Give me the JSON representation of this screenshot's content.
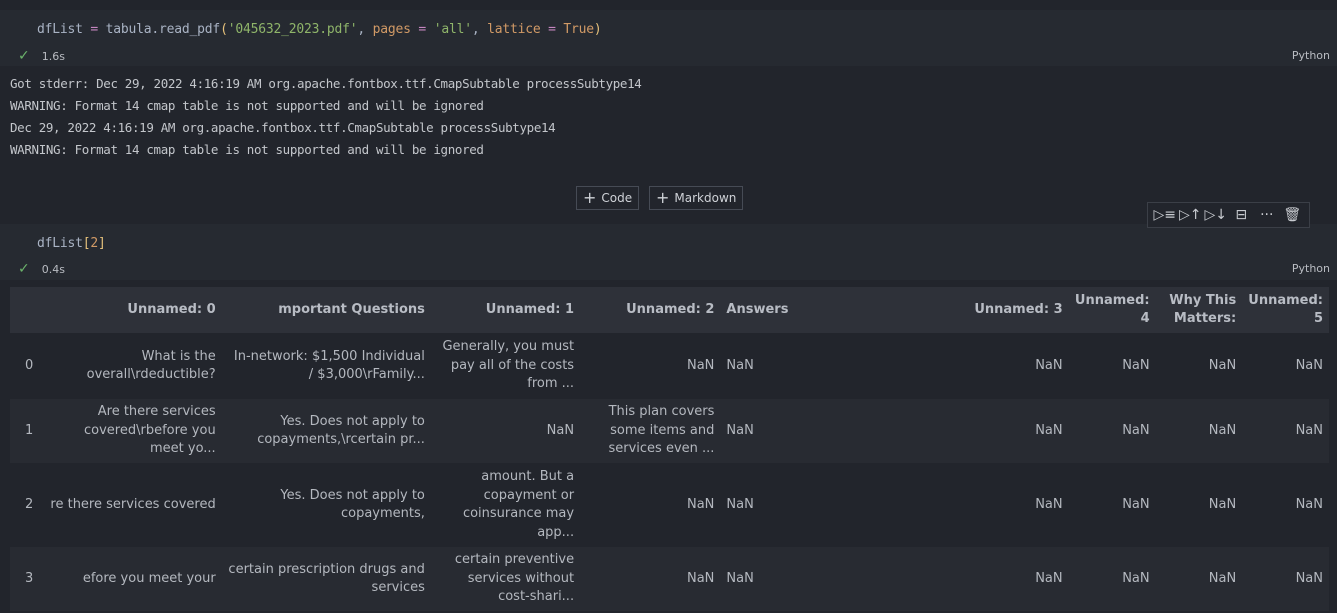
{
  "cells": [
    {
      "code_tokens": [
        {
          "t": "dfList ",
          "c": ""
        },
        {
          "t": "=",
          "c": "tok-op"
        },
        {
          "t": " tabula.read_pdf",
          "c": ""
        },
        {
          "t": "(",
          "c": "tok-paren"
        },
        {
          "t": "'045632_2023.pdf'",
          "c": "tok-str"
        },
        {
          "t": ", ",
          "c": ""
        },
        {
          "t": "pages",
          "c": "tok-kw"
        },
        {
          "t": " ",
          "c": ""
        },
        {
          "t": "=",
          "c": "tok-op"
        },
        {
          "t": " ",
          "c": ""
        },
        {
          "t": "'all'",
          "c": "tok-str"
        },
        {
          "t": ", ",
          "c": ""
        },
        {
          "t": "lattice",
          "c": "tok-kw"
        },
        {
          "t": " ",
          "c": ""
        },
        {
          "t": "=",
          "c": "tok-op"
        },
        {
          "t": " ",
          "c": ""
        },
        {
          "t": "True",
          "c": "tok-kw"
        },
        {
          "t": ")",
          "c": "tok-paren"
        }
      ],
      "exec_time": "1.6s",
      "language": "Python",
      "status_icon": "check-icon",
      "output_lines": [
        "Got stderr: Dec 29, 2022 4:16:19 AM org.apache.fontbox.ttf.CmapSubtable processSubtype14",
        "WARNING: Format 14 cmap table is not supported and will be ignored",
        "Dec 29, 2022 4:16:19 AM org.apache.fontbox.ttf.CmapSubtable processSubtype14",
        "WARNING: Format 14 cmap table is not supported and will be ignored"
      ]
    },
    {
      "code_tokens": [
        {
          "t": "dfList",
          "c": ""
        },
        {
          "t": "[",
          "c": "tok-b1"
        },
        {
          "t": "2",
          "c": "tok-num"
        },
        {
          "t": "]",
          "c": "tok-b1"
        }
      ],
      "exec_time": "0.4s",
      "language": "Python",
      "status_icon": "check-icon"
    }
  ],
  "insert_buttons": {
    "code_label": "Code",
    "markdown_label": "Markdown",
    "plus": "+"
  },
  "cell_toolbar": [
    {
      "name": "run-by-line-icon",
      "glyph": "▷≡"
    },
    {
      "name": "run-above-icon",
      "glyph": "▷↑"
    },
    {
      "name": "run-below-icon",
      "glyph": "▷↓"
    },
    {
      "name": "split-cell-icon",
      "glyph": "⊟"
    },
    {
      "name": "more-actions-icon",
      "glyph": "···"
    },
    {
      "name": "delete-cell-icon",
      "glyph": "🗑"
    }
  ],
  "dataframe": {
    "columns": [
      "",
      "Unnamed: 0",
      "mportant Questions",
      "Unnamed: 1",
      "Unnamed: 2",
      "Answers",
      "Unnamed: 3",
      "Unnamed: 4",
      "Why This Matters:",
      "Unnamed: 5"
    ],
    "rows": [
      [
        "0",
        "What is the overall\\rdeductible?",
        "In-network: $1,500 Individual / $3,000\\rFamily...",
        "Generally, you must pay all of the costs from ...",
        "NaN",
        "NaN",
        "NaN",
        "NaN",
        "NaN",
        "NaN"
      ],
      [
        "1",
        "Are there services covered\\rbefore you meet yo...",
        "Yes. Does not apply to copayments,\\rcertain pr...",
        "NaN",
        "This plan covers some items and services even ...",
        "NaN",
        "NaN",
        "NaN",
        "NaN",
        "NaN"
      ],
      [
        "2",
        "re there services covered",
        "Yes. Does not apply to copayments,",
        "amount. But a copayment or coinsurance may app...",
        "NaN",
        "NaN",
        "NaN",
        "NaN",
        "NaN",
        "NaN"
      ],
      [
        "3",
        "efore you meet your",
        "certain prescription drugs and services",
        "certain preventive services without cost-shari...",
        "NaN",
        "NaN",
        "NaN",
        "NaN",
        "NaN",
        "NaN"
      ]
    ]
  }
}
